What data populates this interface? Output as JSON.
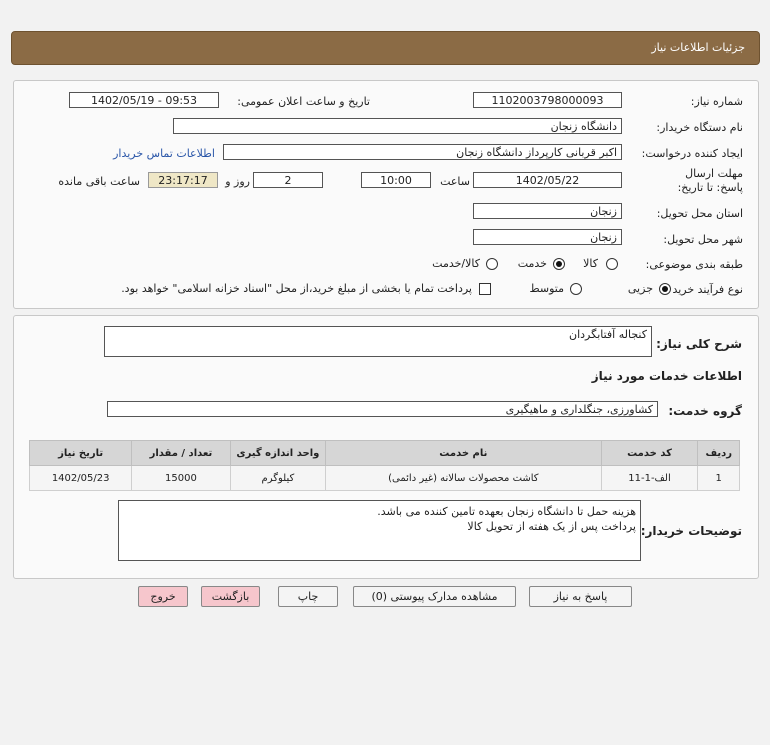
{
  "header": {
    "title": "جزئیات اطلاعات نیاز"
  },
  "form": {
    "need_number_label": "شماره نیاز:",
    "need_number": "1102003798000093",
    "announce_label": "تاریخ و ساعت اعلان عمومی:",
    "announce_value": "1402/05/19 - 09:53",
    "buyer_org_label": "نام دستگاه خریدار:",
    "buyer_org": "دانشگاه زنجان",
    "requester_label": "ایجاد کننده درخواست:",
    "requester": "اکبر قربانی کارپرداز دانشگاه زنجان",
    "contact_link": "اطلاعات تماس خریدار",
    "deadline_label": "مهلت ارسال پاسخ: تا تاریخ:",
    "deadline_date": "1402/05/22",
    "time_label": "ساعت",
    "deadline_time": "10:00",
    "days_value": "2",
    "days_label": "روز و",
    "remaining_time": "23:17:17",
    "remaining_label": "ساعت باقی مانده",
    "province_label": "استان محل تحویل:",
    "province": "زنجان",
    "city_label": "شهر محل تحویل:",
    "city": "زنجان",
    "category_label": "طبقه بندی موضوعی:",
    "category_options": [
      "کالا",
      "خدمت",
      "کالا/خدمت"
    ],
    "category_selected": "خدمت",
    "process_label": "نوع فرآیند خرید :",
    "process_options": [
      "جزیی",
      "متوسط"
    ],
    "process_selected": "جزیی",
    "payment_note": "پرداخت تمام یا بخشی از مبلغ خرید،از محل \"اسناد خزانه اسلامی\" خواهد بود."
  },
  "details": {
    "summary_label": "شرح کلی نیاز:",
    "summary": "کنجاله آفتابگردان",
    "services_heading": "اطلاعات خدمات مورد نیاز",
    "service_group_label": "گروه خدمت:",
    "service_group": "کشاورزی، جنگلداری و ماهیگیری",
    "table_headers": [
      "ردیف",
      "کد خدمت",
      "نام خدمت",
      "واحد اندازه گیری",
      "تعداد / مقدار",
      "تاریخ نیاز"
    ],
    "rows": [
      {
        "row": "1",
        "code": "الف-1-11",
        "name": "کاشت محصولات سالانه (غیر دائمی)",
        "unit": "کیلوگرم",
        "qty": "15000",
        "date": "1402/05/23"
      }
    ],
    "buyer_notes_label": "توضیحات خریدار:",
    "buyer_notes_line1": "هزینه حمل تا دانشگاه زنجان بعهده تامین کننده می باشد.",
    "buyer_notes_line2": "پرداخت پس از یک هفته از تحویل کالا"
  },
  "buttons": {
    "respond": "پاسخ به نیاز",
    "view_docs": "مشاهده مدارک پیوستی (0)",
    "print": "چاپ",
    "back": "بازگشت",
    "exit": "خروج"
  }
}
